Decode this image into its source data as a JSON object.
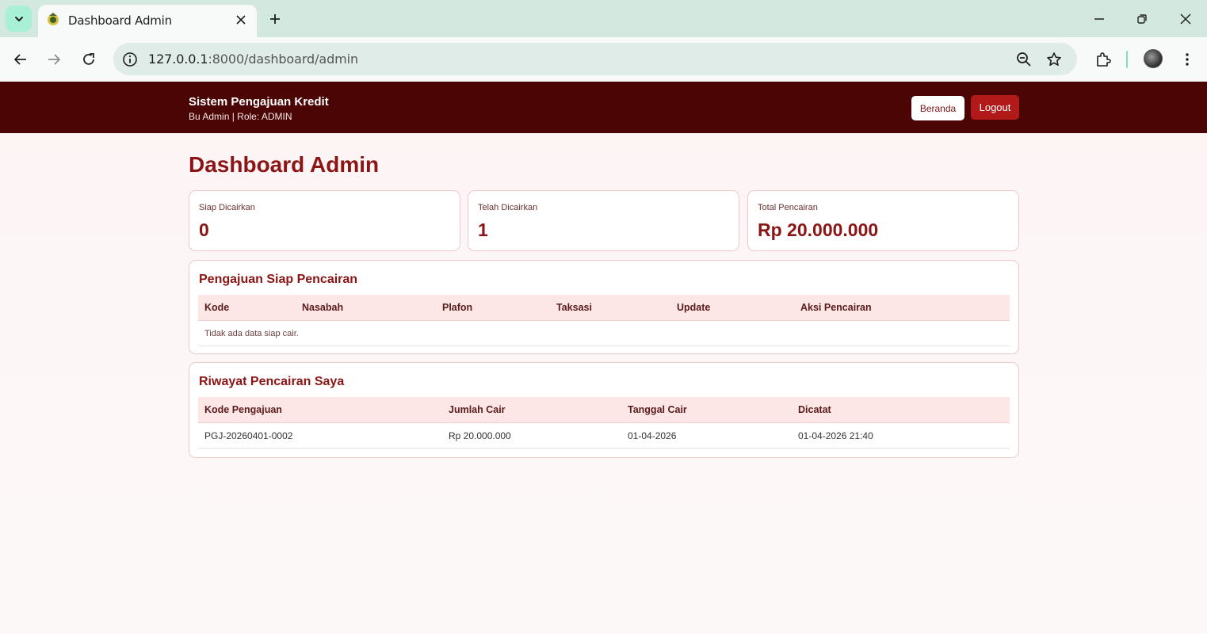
{
  "browser": {
    "tab_title": "Dashboard Admin",
    "url_host": "127.0.0.1",
    "url_rest": ":8000/dashboard/admin",
    "icons": [
      "chevron-down-icon",
      "tab-favicon-icon",
      "close-icon",
      "plus-icon",
      "minimize-icon",
      "restore-icon",
      "window-close-icon",
      "back-arrow-icon",
      "forward-arrow-icon",
      "reload-icon",
      "info-icon",
      "zoom-out-icon",
      "star-icon",
      "extensions-icon",
      "kebab-menu-icon"
    ]
  },
  "app": {
    "title": "Sistem Pengajuan Kredit",
    "user_line": "Bu Admin | Role: ADMIN",
    "nav_home": "Beranda",
    "nav_logout": "Logout",
    "colors": {
      "header": "#4c0505",
      "accent": "#8b1414",
      "logout": "#b21a1a"
    }
  },
  "dashboard": {
    "heading": "Dashboard Admin",
    "stats": [
      {
        "label": "Siap Dicairkan",
        "value": "0"
      },
      {
        "label": "Telah Dicairkan",
        "value": "1"
      },
      {
        "label": "Total Pencairan",
        "value": "Rp 20.000.000"
      }
    ]
  },
  "ready_table": {
    "title": "Pengajuan Siap Pencairan",
    "columns": [
      "Kode",
      "Nasabah",
      "Plafon",
      "Taksasi",
      "Update",
      "Aksi Pencairan"
    ],
    "empty_message": "Tidak ada data siap cair."
  },
  "history_table": {
    "title": "Riwayat Pencairan Saya",
    "columns": [
      "Kode Pengajuan",
      "Jumlah Cair",
      "Tanggal Cair",
      "Dicatat"
    ],
    "rows": [
      [
        "PGJ-20260401-0002",
        "Rp 20.000.000",
        "01-04-2026",
        "01-04-2026 21:40"
      ]
    ]
  }
}
